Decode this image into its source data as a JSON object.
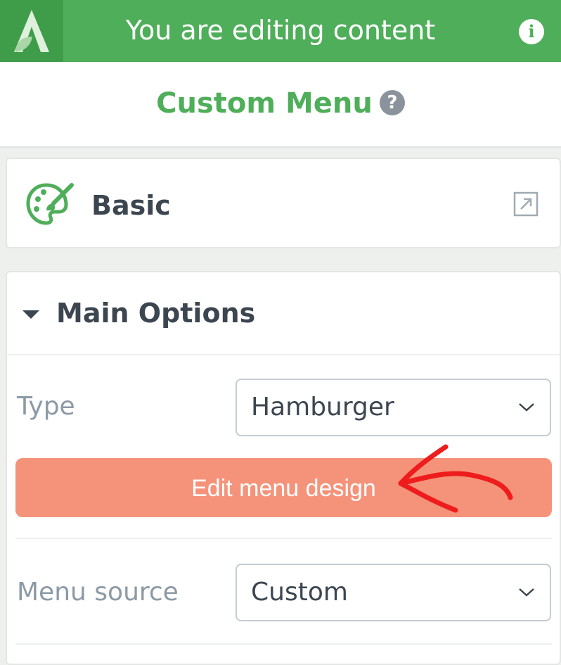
{
  "topbar": {
    "title": "You are editing content",
    "brand_color": "#4fae59",
    "info_icon": "info-icon"
  },
  "panel": {
    "title": "Custom Menu",
    "help_icon": "question-icon"
  },
  "basic": {
    "label": "Basic",
    "icon": "palette-icon",
    "action_icon": "external-link-icon"
  },
  "main_options": {
    "title": "Main Options",
    "type": {
      "label": "Type",
      "value": "Hamburger"
    },
    "edit_button": {
      "label": "Edit menu design",
      "color": "#f5937a"
    },
    "menu_source": {
      "label": "Menu source",
      "value": "Custom"
    }
  },
  "annotation": {
    "color": "#ee1c1c",
    "icon": "red-arrow-annotation"
  }
}
